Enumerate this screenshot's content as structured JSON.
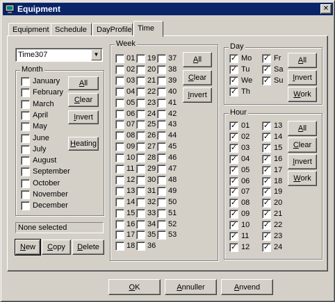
{
  "window": {
    "title": "Equipment"
  },
  "tabs": [
    {
      "label": "Equipment"
    },
    {
      "label": "Schedule"
    },
    {
      "label": "DayProfile"
    },
    {
      "label": "Time",
      "active": true
    }
  ],
  "time_selector": {
    "value": "Time307"
  },
  "month": {
    "label": "Month",
    "items": [
      {
        "label": "January",
        "checked": false
      },
      {
        "label": "February",
        "checked": false
      },
      {
        "label": "March",
        "checked": false
      },
      {
        "label": "April",
        "checked": false
      },
      {
        "label": "May",
        "checked": false
      },
      {
        "label": "June",
        "checked": false
      },
      {
        "label": "July",
        "checked": false
      },
      {
        "label": "August",
        "checked": false
      },
      {
        "label": "September",
        "checked": false
      },
      {
        "label": "October",
        "checked": false
      },
      {
        "label": "November",
        "checked": false
      },
      {
        "label": "December",
        "checked": false
      }
    ],
    "buttons": {
      "all": "All",
      "clear": "Clear",
      "invert": "Invert",
      "heating": "Heating"
    }
  },
  "status": {
    "text": "None selected"
  },
  "record_buttons": {
    "new": "New",
    "copy": "Copy",
    "delete": "Delete"
  },
  "week": {
    "label": "Week",
    "columns": [
      [
        "01",
        "02",
        "03",
        "04",
        "05",
        "06",
        "07",
        "08",
        "09",
        "10",
        "11",
        "12",
        "13",
        "14",
        "15",
        "16",
        "17",
        "18"
      ],
      [
        "19",
        "20",
        "21",
        "22",
        "23",
        "24",
        "25",
        "26",
        "27",
        "28",
        "29",
        "30",
        "31",
        "32",
        "33",
        "34",
        "35",
        "36"
      ],
      [
        "37",
        "38",
        "39",
        "40",
        "41",
        "42",
        "43",
        "44",
        "45",
        "46",
        "47",
        "48",
        "49",
        "50",
        "51",
        "52",
        "53"
      ]
    ],
    "buttons": {
      "all": "All",
      "clear": "Clear",
      "invert": "Invert"
    }
  },
  "day": {
    "label": "Day",
    "items": [
      {
        "label": "Mo",
        "checked": true
      },
      {
        "label": "Tu",
        "checked": true
      },
      {
        "label": "We",
        "checked": true
      },
      {
        "label": "Th",
        "checked": true
      },
      {
        "label": "Fr",
        "checked": true
      },
      {
        "label": "Sa",
        "checked": true
      },
      {
        "label": "Su",
        "checked": true
      }
    ],
    "buttons": {
      "all": "All",
      "invert": "Invert",
      "work": "Work"
    }
  },
  "hour": {
    "label": "Hour",
    "columns": [
      [
        "01",
        "02",
        "03",
        "04",
        "05",
        "06",
        "07",
        "08",
        "09",
        "10",
        "11",
        "12"
      ],
      [
        "13",
        "14",
        "15",
        "16",
        "17",
        "18",
        "19",
        "20",
        "21",
        "22",
        "23",
        "24"
      ]
    ],
    "checked": true,
    "buttons": {
      "all": "All",
      "clear": "Clear",
      "invert": "Invert",
      "work": "Work"
    }
  },
  "footer": {
    "ok": "OK",
    "cancel": "Annuller",
    "apply": "Anvend"
  },
  "colors": {
    "titlebar": "#0a246a",
    "face": "#d4d0c8"
  }
}
